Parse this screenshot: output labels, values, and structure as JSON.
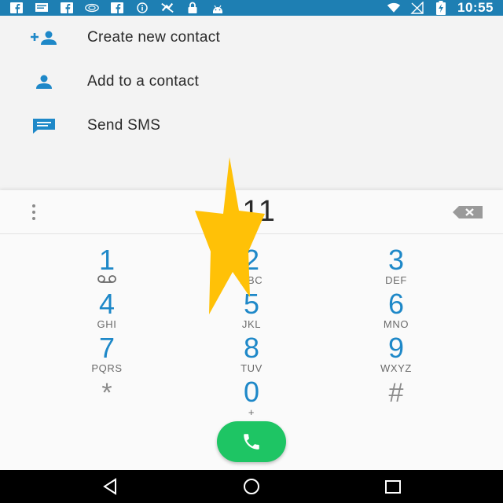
{
  "status_bar": {
    "time": "10:55",
    "left_icons": [
      "facebook-icon",
      "message-icon",
      "facebook-icon",
      "tv-icon",
      "facebook-icon",
      "info-icon",
      "no-fan-icon",
      "lock-icon",
      "android-icon"
    ],
    "right_icons": [
      "wifi-icon",
      "no-signal-icon",
      "battery-charging-icon"
    ]
  },
  "actions": [
    {
      "label": "Create new contact",
      "icon": "add-person-icon"
    },
    {
      "label": "Add to a contact",
      "icon": "person-icon"
    },
    {
      "label": "Send SMS",
      "icon": "message-icon"
    }
  ],
  "dialpad": {
    "digits": "111",
    "keys": [
      {
        "digit": "1",
        "letters": ""
      },
      {
        "digit": "2",
        "letters": "ABC"
      },
      {
        "digit": "3",
        "letters": "DEF"
      },
      {
        "digit": "4",
        "letters": "GHI"
      },
      {
        "digit": "5",
        "letters": "JKL"
      },
      {
        "digit": "6",
        "letters": "MNO"
      },
      {
        "digit": "7",
        "letters": "PQRS"
      },
      {
        "digit": "8",
        "letters": "TUV"
      },
      {
        "digit": "9",
        "letters": "WXYZ"
      },
      {
        "digit": "*",
        "letters": ""
      },
      {
        "digit": "0",
        "letters": "+"
      },
      {
        "digit": "#",
        "letters": ""
      }
    ]
  },
  "colors": {
    "status_bar": "#1e7fb3",
    "accent": "#1e88c8",
    "call": "#1ec564",
    "star": "#ffc107"
  }
}
